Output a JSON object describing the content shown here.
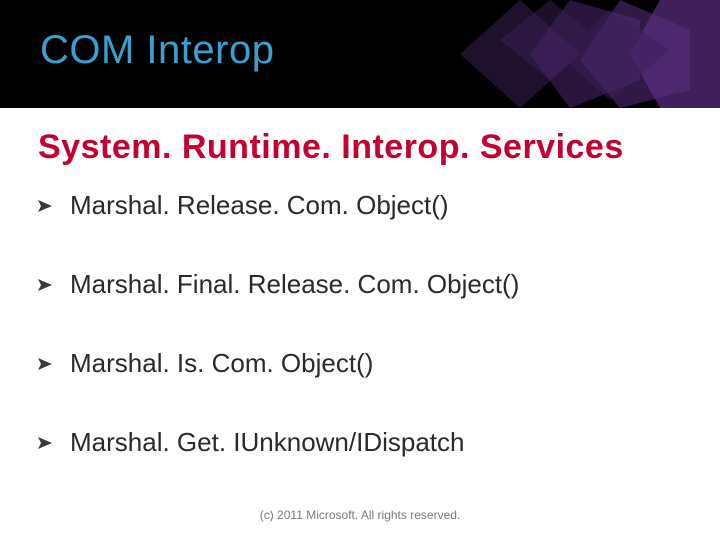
{
  "title": "COM Interop",
  "subheading": "System. Runtime. Interop. Services",
  "bullets": [
    "Marshal. Release. Com. Object()",
    "Marshal. Final. Release. Com. Object()",
    "Marshal. Is. Com. Object()",
    "Marshal. Get. IUnknown/IDispatch"
  ],
  "footer": "(c) 2011 Microsoft. All rights reserved."
}
